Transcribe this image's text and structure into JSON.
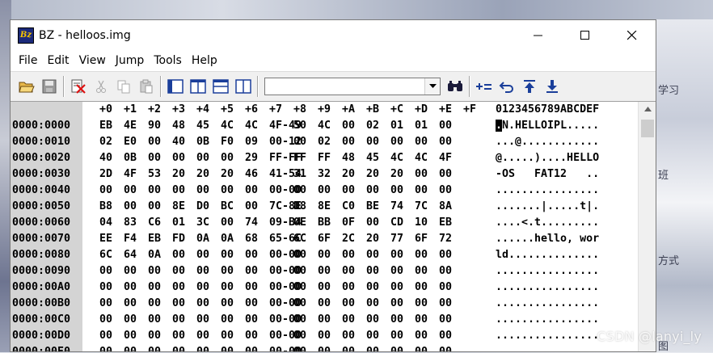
{
  "desktop": {
    "side_labels": [
      "学习",
      "班",
      "方式",
      "图"
    ],
    "watermark": "CSDN @lanyi_ly"
  },
  "window": {
    "title": "BZ - helloos.img",
    "app_icon_text": "Bz"
  },
  "menu": [
    "File",
    "Edit",
    "View",
    "Jump",
    "Tools",
    "Help"
  ],
  "toolbar": {
    "buttons": [
      "open-icon",
      "save-icon",
      "cut-mark-icon",
      "cut-icon",
      "copy-icon",
      "paste-icon",
      "view-single-icon",
      "view-split-v-icon",
      "view-split-h-icon",
      "view-compare-icon",
      "find-icon",
      "increment-icon",
      "back-icon",
      "jump-up-icon",
      "download-icon"
    ],
    "search_value": ""
  },
  "hex": {
    "header_offsets": [
      "+0",
      "+1",
      "+2",
      "+3",
      "+4",
      "+5",
      "+6",
      "+7",
      "+8",
      "+9",
      "+A",
      "+B",
      "+C",
      "+D",
      "+E",
      "+F"
    ],
    "header_ascii": "0123456789ABCDEF",
    "rows": [
      {
        "addr": "0000:0000",
        "bytes": [
          "EB",
          "4E",
          "90",
          "48",
          "45",
          "4C",
          "4C",
          "4F-49",
          "50",
          "4C",
          "00",
          "02",
          "01",
          "01",
          "00"
        ],
        "ascii": ".N.HELLOIPL....."
      },
      {
        "addr": "0000:0010",
        "bytes": [
          "02",
          "E0",
          "00",
          "40",
          "0B",
          "F0",
          "09",
          "00-12",
          "00",
          "02",
          "00",
          "00",
          "00",
          "00",
          "00"
        ],
        "ascii": "...@............"
      },
      {
        "addr": "0000:0020",
        "bytes": [
          "40",
          "0B",
          "00",
          "00",
          "00",
          "00",
          "29",
          "FF-FF",
          "FF",
          "FF",
          "48",
          "45",
          "4C",
          "4C",
          "4F"
        ],
        "ascii": "@.....)....HELLO"
      },
      {
        "addr": "0000:0030",
        "bytes": [
          "2D",
          "4F",
          "53",
          "20",
          "20",
          "20",
          "46",
          "41-54",
          "31",
          "32",
          "20",
          "20",
          "20",
          "00",
          "00"
        ],
        "ascii": "-OS   FAT12   .."
      },
      {
        "addr": "0000:0040",
        "bytes": [
          "00",
          "00",
          "00",
          "00",
          "00",
          "00",
          "00",
          "00-00",
          "00",
          "00",
          "00",
          "00",
          "00",
          "00",
          "00"
        ],
        "ascii": "................"
      },
      {
        "addr": "0000:0050",
        "bytes": [
          "B8",
          "00",
          "00",
          "8E",
          "D0",
          "BC",
          "00",
          "7C-8E",
          "D8",
          "8E",
          "C0",
          "BE",
          "74",
          "7C",
          "8A"
        ],
        "ascii": ".......|.....t|."
      },
      {
        "addr": "0000:0060",
        "bytes": [
          "04",
          "83",
          "C6",
          "01",
          "3C",
          "00",
          "74",
          "09-B4",
          "0E",
          "BB",
          "0F",
          "00",
          "CD",
          "10",
          "EB"
        ],
        "ascii": "....<.t........."
      },
      {
        "addr": "0000:0070",
        "bytes": [
          "EE",
          "F4",
          "EB",
          "FD",
          "0A",
          "0A",
          "68",
          "65-6C",
          "6C",
          "6F",
          "2C",
          "20",
          "77",
          "6F",
          "72"
        ],
        "ascii": "......hello, wor"
      },
      {
        "addr": "0000:0080",
        "bytes": [
          "6C",
          "64",
          "0A",
          "00",
          "00",
          "00",
          "00",
          "00-00",
          "00",
          "00",
          "00",
          "00",
          "00",
          "00",
          "00"
        ],
        "ascii": "ld.............."
      },
      {
        "addr": "0000:0090",
        "bytes": [
          "00",
          "00",
          "00",
          "00",
          "00",
          "00",
          "00",
          "00-00",
          "00",
          "00",
          "00",
          "00",
          "00",
          "00",
          "00"
        ],
        "ascii": "................"
      },
      {
        "addr": "0000:00A0",
        "bytes": [
          "00",
          "00",
          "00",
          "00",
          "00",
          "00",
          "00",
          "00-00",
          "00",
          "00",
          "00",
          "00",
          "00",
          "00",
          "00"
        ],
        "ascii": "................"
      },
      {
        "addr": "0000:00B0",
        "bytes": [
          "00",
          "00",
          "00",
          "00",
          "00",
          "00",
          "00",
          "00-00",
          "00",
          "00",
          "00",
          "00",
          "00",
          "00",
          "00"
        ],
        "ascii": "................"
      },
      {
        "addr": "0000:00C0",
        "bytes": [
          "00",
          "00",
          "00",
          "00",
          "00",
          "00",
          "00",
          "00-00",
          "00",
          "00",
          "00",
          "00",
          "00",
          "00",
          "00"
        ],
        "ascii": "................"
      },
      {
        "addr": "0000:00D0",
        "bytes": [
          "00",
          "00",
          "00",
          "00",
          "00",
          "00",
          "00",
          "00-00",
          "00",
          "00",
          "00",
          "00",
          "00",
          "00",
          "00"
        ],
        "ascii": "................"
      },
      {
        "addr": "0000:00E0",
        "bytes": [
          "00",
          "00",
          "00",
          "00",
          "00",
          "00",
          "00",
          "00-00",
          "00",
          "00",
          "00",
          "00",
          "00",
          "00",
          "00"
        ],
        "ascii": "................"
      }
    ],
    "cursor": {
      "row": 0,
      "col": 0
    }
  }
}
